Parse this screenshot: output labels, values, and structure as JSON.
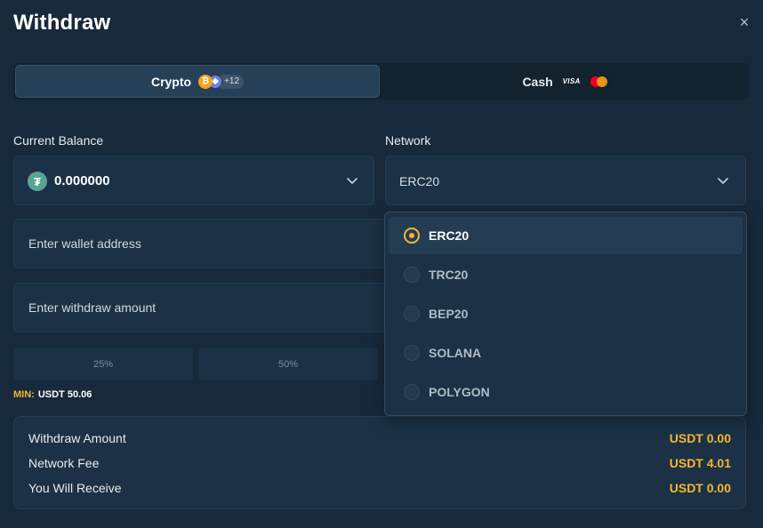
{
  "dialog": {
    "title": "Withdraw",
    "close": "×"
  },
  "tabs": {
    "crypto": {
      "label": "Crypto",
      "more_coins": "+12"
    },
    "cash": {
      "label": "Cash",
      "visa": "VISA"
    }
  },
  "balance": {
    "label": "Current Balance",
    "value": "0.000000",
    "icon": "usdt-tether-icon"
  },
  "network": {
    "label": "Network",
    "selected": "ERC20",
    "options": [
      "ERC20",
      "TRC20",
      "BEP20",
      "SOLANA",
      "POLYGON"
    ]
  },
  "wallet": {
    "placeholder": "Enter wallet address"
  },
  "amount": {
    "placeholder": "Enter withdraw amount"
  },
  "quick_percent": [
    "25%",
    "50%"
  ],
  "min": {
    "label": "MIN:",
    "value": "USDT 50.06"
  },
  "summary": {
    "rows": [
      {
        "label": "Withdraw Amount",
        "value": "USDT 0.00"
      },
      {
        "label": "Network Fee",
        "value": "USDT 4.01"
      },
      {
        "label": "You Will Receive",
        "value": "USDT 0.00"
      }
    ]
  },
  "colors": {
    "accent": "#f5b731",
    "background": "#17293a",
    "field": "#1c3145",
    "tether": "#56a592"
  }
}
